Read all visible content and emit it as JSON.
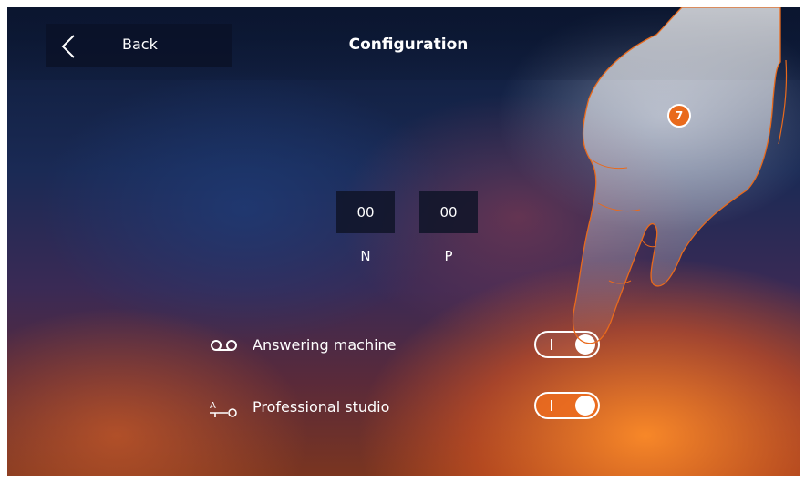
{
  "header": {
    "back_label": "Back",
    "title": "Configuration"
  },
  "address": {
    "n_value": "00",
    "p_value": "00",
    "n_label": "N",
    "p_label": "P"
  },
  "settings": {
    "answering_machine": {
      "label": "Answering machine",
      "icon": "voicemail-icon",
      "toggle_mark": "I"
    },
    "professional_studio": {
      "label": "Professional studio",
      "icon": "door-key-icon",
      "icon_letter": "A",
      "toggle_mark": "I"
    }
  },
  "annotation": {
    "step_number": "7"
  },
  "colors": {
    "accent": "#e96a1c",
    "text": "#ffffff"
  }
}
